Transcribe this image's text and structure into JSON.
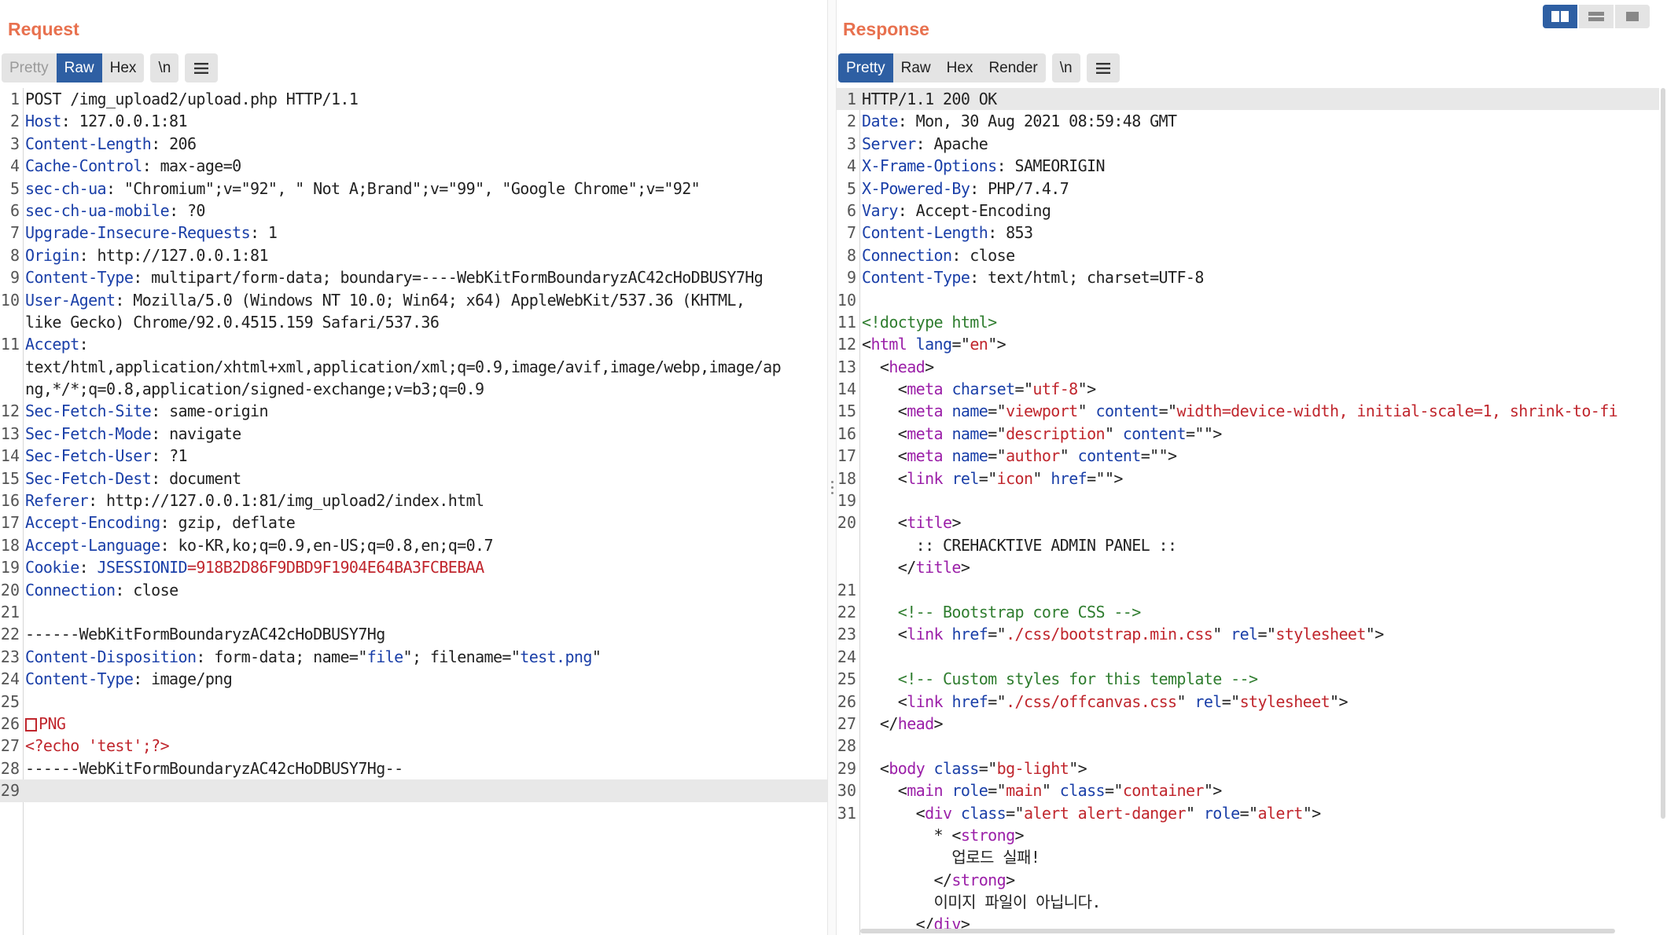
{
  "request": {
    "title": "Request",
    "tabs": [
      "Pretty",
      "Raw",
      "Hex"
    ],
    "active_tab": "Raw",
    "newline_toggle": "\\n",
    "lines": [
      {
        "n": "1",
        "parts": [
          [
            "POST /img_upload2/upload.php HTTP/1.1",
            ""
          ]
        ]
      },
      {
        "n": "2",
        "parts": [
          [
            "Host",
            "k"
          ],
          [
            ": 127.0.0.1:81",
            ""
          ]
        ]
      },
      {
        "n": "3",
        "parts": [
          [
            "Content-Length",
            "k"
          ],
          [
            ": 206",
            ""
          ]
        ]
      },
      {
        "n": "4",
        "parts": [
          [
            "Cache-Control",
            "k"
          ],
          [
            ": max-age=0",
            ""
          ]
        ]
      },
      {
        "n": "5",
        "parts": [
          [
            "sec-ch-ua",
            "k"
          ],
          [
            ": \"Chromium\";v=\"92\", \" Not A;Brand\";v=\"99\", \"Google Chrome\";v=\"92\"",
            ""
          ]
        ]
      },
      {
        "n": "6",
        "parts": [
          [
            "sec-ch-ua-mobile",
            "k"
          ],
          [
            ": ?0",
            ""
          ]
        ]
      },
      {
        "n": "7",
        "parts": [
          [
            "Upgrade-Insecure-Requests",
            "k"
          ],
          [
            ": 1",
            ""
          ]
        ]
      },
      {
        "n": "8",
        "parts": [
          [
            "Origin",
            "k"
          ],
          [
            ": http://127.0.0.1:81",
            ""
          ]
        ]
      },
      {
        "n": "9",
        "parts": [
          [
            "Content-Type",
            "k"
          ],
          [
            ": multipart/form-data; boundary=----WebKitFormBoundaryzAC42cHoDBUSY7Hg",
            ""
          ]
        ]
      },
      {
        "n": "10",
        "parts": [
          [
            "User-Agent",
            "k"
          ],
          [
            ": Mozilla/5.0 (Windows NT 10.0; Win64; x64) AppleWebKit/537.36 (KHTML,",
            ""
          ]
        ]
      },
      {
        "n": "",
        "parts": [
          [
            "like Gecko) Chrome/92.0.4515.159 Safari/537.36",
            ""
          ]
        ]
      },
      {
        "n": "11",
        "parts": [
          [
            "Accept",
            "k"
          ],
          [
            ":",
            ""
          ]
        ]
      },
      {
        "n": "",
        "parts": [
          [
            "text/html,application/xhtml+xml,application/xml;q=0.9,image/avif,image/webp,image/ap",
            ""
          ]
        ]
      },
      {
        "n": "",
        "parts": [
          [
            "ng,*/*;q=0.8,application/signed-exchange;v=b3;q=0.9",
            ""
          ]
        ]
      },
      {
        "n": "12",
        "parts": [
          [
            "Sec-Fetch-Site",
            "k"
          ],
          [
            ": same-origin",
            ""
          ]
        ]
      },
      {
        "n": "13",
        "parts": [
          [
            "Sec-Fetch-Mode",
            "k"
          ],
          [
            ": navigate",
            ""
          ]
        ]
      },
      {
        "n": "14",
        "parts": [
          [
            "Sec-Fetch-User",
            "k"
          ],
          [
            ": ?1",
            ""
          ]
        ]
      },
      {
        "n": "15",
        "parts": [
          [
            "Sec-Fetch-Dest",
            "k"
          ],
          [
            ": document",
            ""
          ]
        ]
      },
      {
        "n": "16",
        "parts": [
          [
            "Referer",
            "k"
          ],
          [
            ": http://127.0.0.1:81/img_upload2/index.html",
            ""
          ]
        ]
      },
      {
        "n": "17",
        "parts": [
          [
            "Accept-Encoding",
            "k"
          ],
          [
            ": gzip, deflate",
            ""
          ]
        ]
      },
      {
        "n": "18",
        "parts": [
          [
            "Accept-Language",
            "k"
          ],
          [
            ": ko-KR,ko;q=0.9,en-US;q=0.8,en;q=0.7",
            ""
          ]
        ]
      },
      {
        "n": "19",
        "parts": [
          [
            "Cookie",
            "k"
          ],
          [
            ": ",
            ""
          ],
          [
            "JSESSIONID",
            "blue"
          ],
          [
            "=918B2D86F9DBD9F1904E64BA3FCBEBAA",
            "red"
          ]
        ]
      },
      {
        "n": "20",
        "parts": [
          [
            "Connection",
            "k"
          ],
          [
            ": close",
            ""
          ]
        ]
      },
      {
        "n": "21",
        "parts": []
      },
      {
        "n": "22",
        "parts": [
          [
            "------WebKitFormBoundaryzAC42cHoDBUSY7Hg",
            ""
          ]
        ]
      },
      {
        "n": "23",
        "parts": [
          [
            "Content-Disposition",
            "k"
          ],
          [
            ": form-data; name=\"",
            ""
          ],
          [
            "file",
            "blue"
          ],
          [
            "\"; filename=\"",
            ""
          ],
          [
            "test.png",
            "blue"
          ],
          [
            "\"",
            ""
          ]
        ]
      },
      {
        "n": "24",
        "parts": [
          [
            "Content-Type",
            "k"
          ],
          [
            ": image/png",
            ""
          ]
        ]
      },
      {
        "n": "25",
        "parts": []
      },
      {
        "n": "26",
        "parts": [
          [
            "□",
            "pngbox"
          ],
          [
            "PNG",
            "red"
          ]
        ]
      },
      {
        "n": "27",
        "parts": [
          [
            "<?echo 'test';?>",
            "red"
          ]
        ]
      },
      {
        "n": "28",
        "parts": [
          [
            "------WebKitFormBoundaryzAC42cHoDBUSY7Hg--",
            ""
          ]
        ]
      },
      {
        "n": "29",
        "parts": [],
        "current": true
      }
    ]
  },
  "response": {
    "title": "Response",
    "tabs": [
      "Pretty",
      "Raw",
      "Hex",
      "Render"
    ],
    "active_tab": "Pretty",
    "newline_toggle": "\\n",
    "lines": [
      {
        "n": "1",
        "parts": [
          [
            "HTTP/1.1 200 OK",
            ""
          ]
        ],
        "current": true
      },
      {
        "n": "2",
        "parts": [
          [
            "Date",
            "k"
          ],
          [
            ": Mon, 30 Aug 2021 08:59:48 GMT",
            ""
          ]
        ]
      },
      {
        "n": "3",
        "parts": [
          [
            "Server",
            "k"
          ],
          [
            ": Apache",
            ""
          ]
        ]
      },
      {
        "n": "4",
        "parts": [
          [
            "X-Frame-Options",
            "k"
          ],
          [
            ": SAMEORIGIN",
            ""
          ]
        ]
      },
      {
        "n": "5",
        "parts": [
          [
            "X-Powered-By",
            "k"
          ],
          [
            ": PHP/7.4.7",
            ""
          ]
        ]
      },
      {
        "n": "6",
        "parts": [
          [
            "Vary",
            "k"
          ],
          [
            ": Accept-Encoding",
            ""
          ]
        ]
      },
      {
        "n": "7",
        "parts": [
          [
            "Content-Length",
            "k"
          ],
          [
            ": 853",
            ""
          ]
        ]
      },
      {
        "n": "8",
        "parts": [
          [
            "Connection",
            "k"
          ],
          [
            ": close",
            ""
          ]
        ]
      },
      {
        "n": "9",
        "parts": [
          [
            "Content-Type",
            "k"
          ],
          [
            ": text/html; charset=UTF-8",
            ""
          ]
        ]
      },
      {
        "n": "10",
        "parts": []
      },
      {
        "n": "11",
        "parts": [
          [
            "<!doctype html>",
            "cmt"
          ]
        ]
      },
      {
        "n": "12",
        "parts": [
          [
            "<",
            ""
          ],
          [
            "html",
            "tag"
          ],
          [
            " ",
            ""
          ],
          [
            "lang",
            "attr"
          ],
          [
            "=\"",
            ""
          ],
          [
            "en",
            "str"
          ],
          [
            "\">",
            ""
          ]
        ]
      },
      {
        "n": "13",
        "parts": [
          [
            "  <",
            ""
          ],
          [
            "head",
            "tag"
          ],
          [
            ">",
            ""
          ]
        ]
      },
      {
        "n": "14",
        "parts": [
          [
            "    <",
            ""
          ],
          [
            "meta",
            "tag"
          ],
          [
            " ",
            ""
          ],
          [
            "charset",
            "attr"
          ],
          [
            "=\"",
            ""
          ],
          [
            "utf-8",
            "str"
          ],
          [
            "\">",
            ""
          ]
        ]
      },
      {
        "n": "15",
        "parts": [
          [
            "    <",
            ""
          ],
          [
            "meta",
            "tag"
          ],
          [
            " ",
            ""
          ],
          [
            "name",
            "attr"
          ],
          [
            "=\"",
            ""
          ],
          [
            "viewport",
            "str"
          ],
          [
            "\" ",
            ""
          ],
          [
            "content",
            "attr"
          ],
          [
            "=\"",
            ""
          ],
          [
            "width=device-width, initial-scale=1, shrink-to-fi",
            "str"
          ]
        ]
      },
      {
        "n": "16",
        "parts": [
          [
            "    <",
            ""
          ],
          [
            "meta",
            "tag"
          ],
          [
            " ",
            ""
          ],
          [
            "name",
            "attr"
          ],
          [
            "=\"",
            ""
          ],
          [
            "description",
            "str"
          ],
          [
            "\" ",
            ""
          ],
          [
            "content",
            "attr"
          ],
          [
            "=\"\">",
            ""
          ]
        ]
      },
      {
        "n": "17",
        "parts": [
          [
            "    <",
            ""
          ],
          [
            "meta",
            "tag"
          ],
          [
            " ",
            ""
          ],
          [
            "name",
            "attr"
          ],
          [
            "=\"",
            ""
          ],
          [
            "author",
            "str"
          ],
          [
            "\" ",
            ""
          ],
          [
            "content",
            "attr"
          ],
          [
            "=\"\">",
            ""
          ]
        ]
      },
      {
        "n": "18",
        "parts": [
          [
            "    <",
            ""
          ],
          [
            "link",
            "tag"
          ],
          [
            " ",
            ""
          ],
          [
            "rel",
            "attr"
          ],
          [
            "=\"",
            ""
          ],
          [
            "icon",
            "str"
          ],
          [
            "\" ",
            ""
          ],
          [
            "href",
            "attr"
          ],
          [
            "=\"\">",
            ""
          ]
        ]
      },
      {
        "n": "19",
        "parts": []
      },
      {
        "n": "20",
        "parts": [
          [
            "    <",
            ""
          ],
          [
            "title",
            "tag"
          ],
          [
            ">",
            ""
          ]
        ]
      },
      {
        "n": "",
        "parts": [
          [
            "      :: CREHACKTIVE ADMIN PANEL ::",
            ""
          ]
        ]
      },
      {
        "n": "",
        "parts": [
          [
            "    </",
            ""
          ],
          [
            "title",
            "tag"
          ],
          [
            ">",
            ""
          ]
        ]
      },
      {
        "n": "21",
        "parts": []
      },
      {
        "n": "22",
        "parts": [
          [
            "    <!-- Bootstrap core CSS -->",
            "cmt"
          ]
        ]
      },
      {
        "n": "23",
        "parts": [
          [
            "    <",
            ""
          ],
          [
            "link",
            "tag"
          ],
          [
            " ",
            ""
          ],
          [
            "href",
            "attr"
          ],
          [
            "=\"",
            ""
          ],
          [
            "./css/bootstrap.min.css",
            "str"
          ],
          [
            "\" ",
            ""
          ],
          [
            "rel",
            "attr"
          ],
          [
            "=\"",
            ""
          ],
          [
            "stylesheet",
            "str"
          ],
          [
            "\">",
            ""
          ]
        ]
      },
      {
        "n": "24",
        "parts": []
      },
      {
        "n": "25",
        "parts": [
          [
            "    <!-- Custom styles for this template -->",
            "cmt"
          ]
        ]
      },
      {
        "n": "26",
        "parts": [
          [
            "    <",
            ""
          ],
          [
            "link",
            "tag"
          ],
          [
            " ",
            ""
          ],
          [
            "href",
            "attr"
          ],
          [
            "=\"",
            ""
          ],
          [
            "./css/offcanvas.css",
            "str"
          ],
          [
            "\" ",
            ""
          ],
          [
            "rel",
            "attr"
          ],
          [
            "=\"",
            ""
          ],
          [
            "stylesheet",
            "str"
          ],
          [
            "\">",
            ""
          ]
        ]
      },
      {
        "n": "27",
        "parts": [
          [
            "  </",
            ""
          ],
          [
            "head",
            "tag"
          ],
          [
            ">",
            ""
          ]
        ]
      },
      {
        "n": "28",
        "parts": []
      },
      {
        "n": "29",
        "parts": [
          [
            "  <",
            ""
          ],
          [
            "body",
            "tag"
          ],
          [
            " ",
            ""
          ],
          [
            "class",
            "attr"
          ],
          [
            "=\"",
            ""
          ],
          [
            "bg-light",
            "str"
          ],
          [
            "\">",
            ""
          ]
        ]
      },
      {
        "n": "30",
        "parts": [
          [
            "    <",
            ""
          ],
          [
            "main",
            "tag"
          ],
          [
            " ",
            ""
          ],
          [
            "role",
            "attr"
          ],
          [
            "=\"",
            ""
          ],
          [
            "main",
            "str"
          ],
          [
            "\" ",
            ""
          ],
          [
            "class",
            "attr"
          ],
          [
            "=\"",
            ""
          ],
          [
            "container",
            "str"
          ],
          [
            "\">",
            ""
          ]
        ]
      },
      {
        "n": "31",
        "parts": [
          [
            "      <",
            ""
          ],
          [
            "div",
            "tag"
          ],
          [
            " ",
            ""
          ],
          [
            "class",
            "attr"
          ],
          [
            "=\"",
            ""
          ],
          [
            "alert alert-danger",
            "str"
          ],
          [
            "\" ",
            ""
          ],
          [
            "role",
            "attr"
          ],
          [
            "=\"",
            ""
          ],
          [
            "alert",
            "str"
          ],
          [
            "\">",
            ""
          ]
        ]
      },
      {
        "n": "",
        "parts": [
          [
            "        * <",
            ""
          ],
          [
            "strong",
            "tag"
          ],
          [
            ">",
            ""
          ]
        ]
      },
      {
        "n": "",
        "parts": [
          [
            "          업로드 실패!",
            ""
          ]
        ]
      },
      {
        "n": "",
        "parts": [
          [
            "        </",
            ""
          ],
          [
            "strong",
            "tag"
          ],
          [
            ">",
            ""
          ]
        ]
      },
      {
        "n": "",
        "parts": [
          [
            "        이미지 파일이 아닙니다.",
            ""
          ]
        ]
      },
      {
        "n": "",
        "parts": [
          [
            "      </",
            ""
          ],
          [
            "div",
            "tag"
          ],
          [
            ">",
            ""
          ]
        ]
      }
    ]
  },
  "layout_toggle": [
    "split-horizontal-icon",
    "split-vertical-icon",
    "single-pane-icon"
  ]
}
